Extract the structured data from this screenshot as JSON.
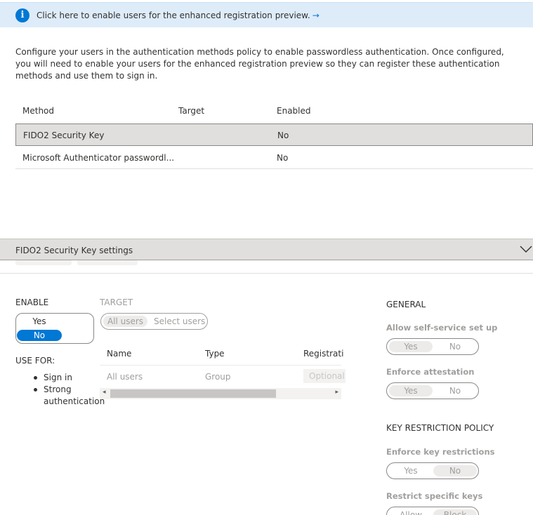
{
  "banner": {
    "icon": "info-icon",
    "text": "Click here to enable users for the enhanced registration preview.",
    "arrow": "→"
  },
  "description": "Configure your users in the authentication methods policy to enable passwordless authentication. Once configured, you will need to enable your users for the enhanced registration preview so they can register these authentication methods and use them to sign in.",
  "methods_grid": {
    "columns": [
      "Method",
      "Target",
      "Enabled"
    ],
    "rows": [
      {
        "method": "FIDO2 Security Key",
        "target": "",
        "enabled": "No"
      },
      {
        "method": "Microsoft Authenticator passwordl...",
        "target": "",
        "enabled": "No"
      }
    ]
  },
  "settings_panel": {
    "title": "FIDO2 Security Key settings",
    "enable": {
      "label": "ENABLE",
      "options": [
        "Yes",
        "No"
      ],
      "selected": "No"
    },
    "use_for": {
      "label": "USE FOR:",
      "items": [
        "Sign in",
        "Strong authentication"
      ]
    },
    "target": {
      "label": "TARGET",
      "options": [
        "All users",
        "Select users"
      ],
      "selected": "All users",
      "columns": [
        "Name",
        "Type",
        "Registrati"
      ],
      "rows": [
        {
          "name": "All users",
          "type": "Group",
          "registration": "Optional"
        }
      ]
    },
    "general": {
      "label": "GENERAL",
      "self_service": {
        "label": "Allow self-service set up",
        "options": [
          "Yes",
          "No"
        ],
        "selected": "Yes"
      },
      "attestation": {
        "label": "Enforce attestation",
        "options": [
          "Yes",
          "No"
        ],
        "selected": "Yes"
      }
    },
    "key_restriction": {
      "label": "KEY RESTRICTION POLICY",
      "enforce": {
        "label": "Enforce key restrictions",
        "options": [
          "Yes",
          "No"
        ],
        "selected": "No"
      },
      "restrict": {
        "label": "Restrict specific keys",
        "options": [
          "Allow",
          "Block"
        ],
        "selected": "Block"
      }
    }
  },
  "colors": {
    "accent": "#0078d4",
    "banner_bg": "#deecf9",
    "selected_row": "#e1dfdd"
  }
}
